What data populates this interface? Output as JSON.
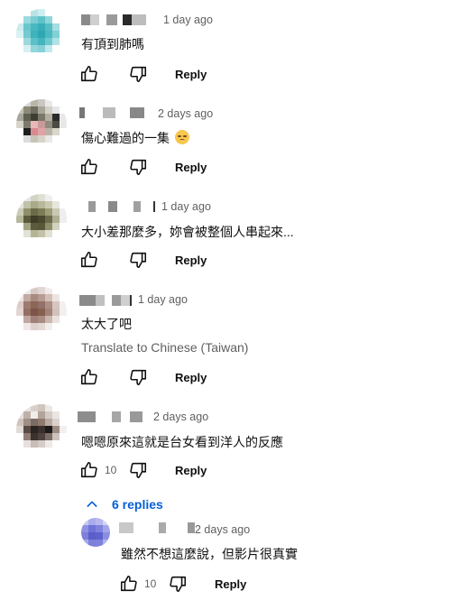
{
  "comments": [
    {
      "time": "1 day ago",
      "text": "有頂到肺嗎",
      "reply_label": "Reply",
      "likes": ""
    },
    {
      "time": "2 days ago",
      "text": "傷心難過的一集",
      "reply_label": "Reply",
      "likes": ""
    },
    {
      "time": "1 day ago",
      "text": "大小差那麼多，妳會被整個人串起來...",
      "reply_label": "Reply",
      "likes": ""
    },
    {
      "time": "1 day ago",
      "text": "太大了吧",
      "translate": "Translate to Chinese (Taiwan)",
      "reply_label": "Reply",
      "likes": ""
    },
    {
      "time": "2 days ago",
      "text": "嗯嗯原來這就是台女看到洋人的反應",
      "reply_label": "Reply",
      "likes": "10"
    }
  ],
  "replies_toggle": {
    "label": "6 replies"
  },
  "reply": {
    "time": "2 days ago",
    "text": "雖然不想這麼說，但影片很真實",
    "reply_label": "Reply",
    "likes": "10"
  },
  "colors": {
    "link_blue": "#065fd4",
    "meta_gray": "#606060",
    "text": "#0f0f0f"
  },
  "icons": [
    "thumbs-up-icon",
    "thumbs-down-icon",
    "chevron-up-icon",
    "emoji-sad-icon"
  ]
}
